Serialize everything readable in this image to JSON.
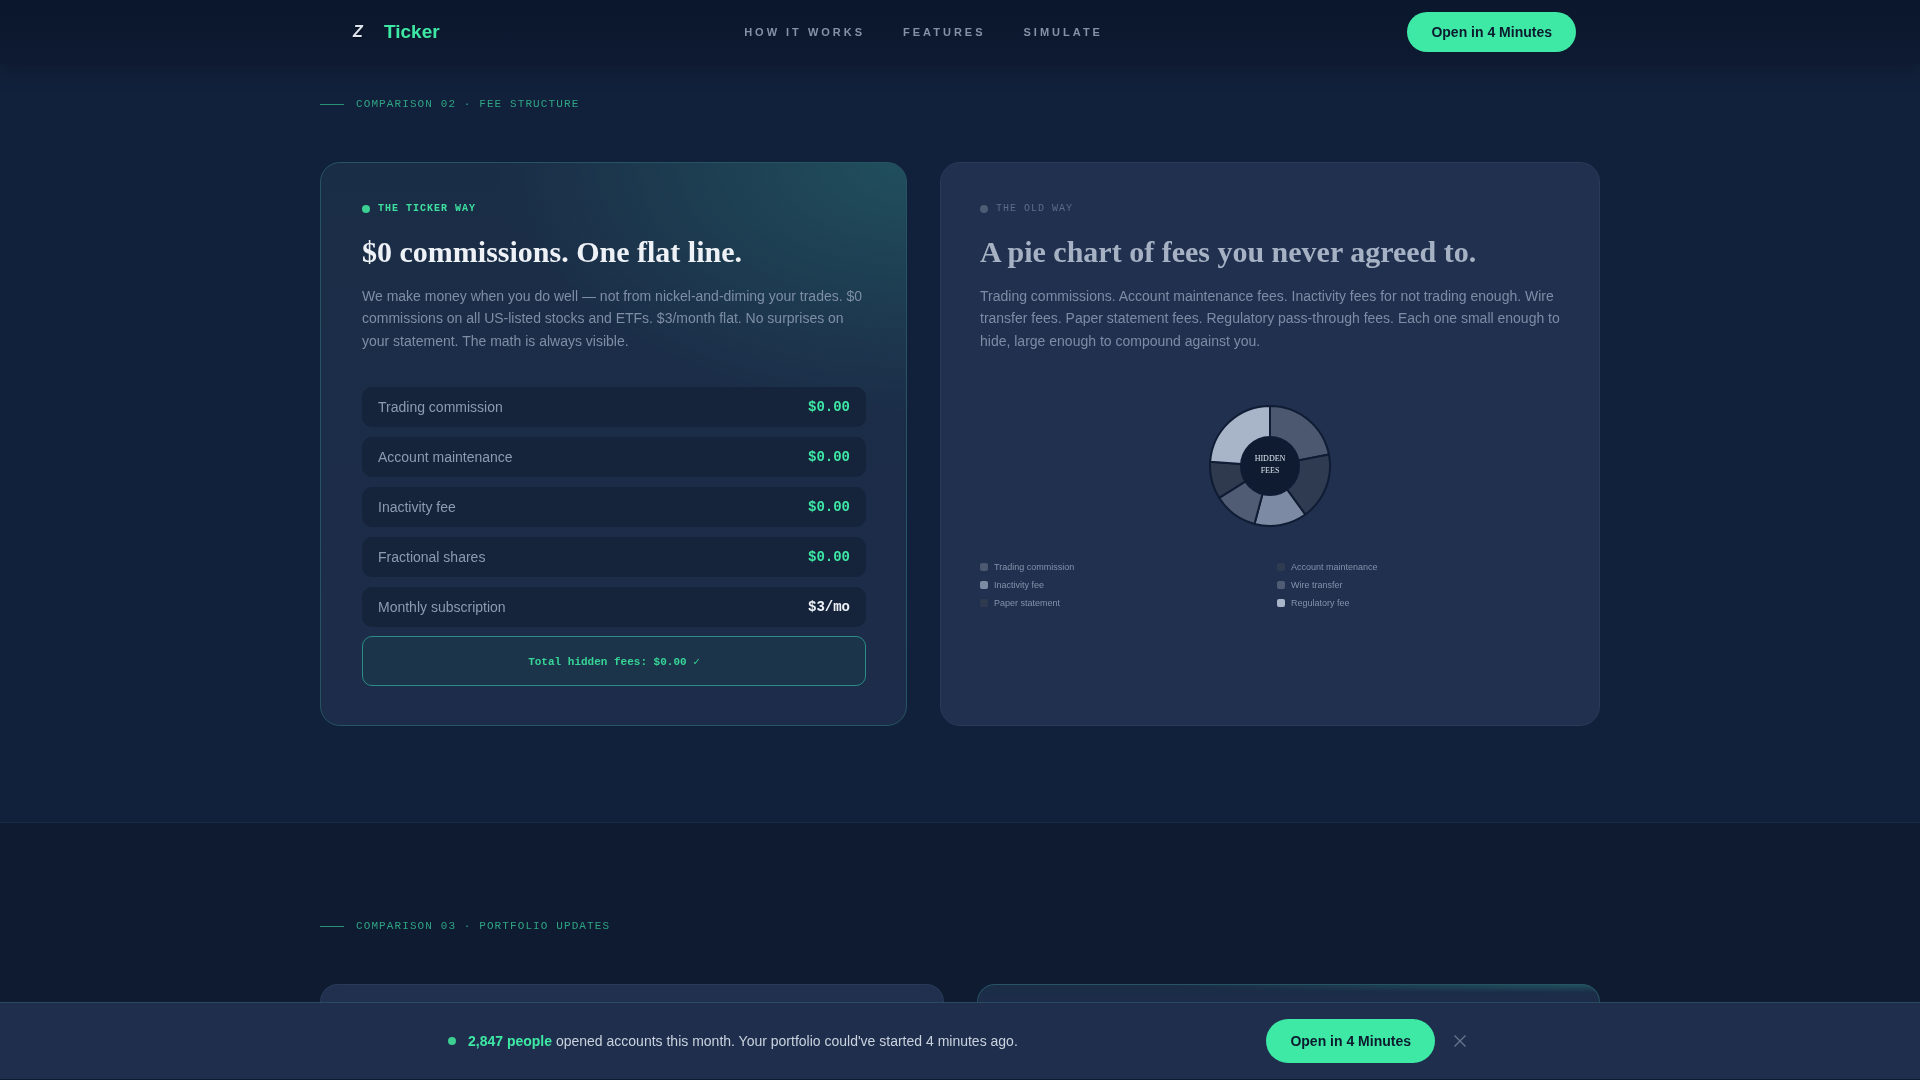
{
  "header": {
    "logo_mark": "Z",
    "brand": "Ticker",
    "nav": [
      "HOW IT WORKS",
      "FEATURES",
      "SIMULATE"
    ],
    "cta": "Open in 4 Minutes"
  },
  "sections": [
    {
      "eyebrow": "COMPARISON 02 · FEE STRUCTURE",
      "cards": [
        {
          "kind": "ticker",
          "tag": "THE TICKER WAY",
          "title": "$0 commissions. One flat line.",
          "body": "We make money when you do well — not from nickel-and-diming your trades. $0 commissions on all US-listed stocks and ETFs. $3/month flat. No surprises on your statement. The math is always visible.",
          "fees": [
            {
              "label": "Trading commission",
              "value": "$0.00",
              "free": true
            },
            {
              "label": "Account maintenance",
              "value": "$0.00",
              "free": true
            },
            {
              "label": "Inactivity fee",
              "value": "$0.00",
              "free": true
            },
            {
              "label": "Fractional shares",
              "value": "$0.00",
              "free": true
            },
            {
              "label": "Monthly subscription",
              "value": "$3/mo",
              "free": false
            }
          ],
          "total": "Total hidden fees: $0.00 ✓"
        },
        {
          "kind": "old",
          "tag": "THE OLD WAY",
          "title": "A pie chart of fees you never agreed to.",
          "body": "Trading commissions. Account maintenance fees. Inactivity fees for not trading enough. Wire transfer fees. Paper statement fees. Regulatory pass-through fees. Each one small enough to hide, large enough to compound against you.",
          "pie_label": "HIDDEN FEES",
          "legend": [
            {
              "label": "Trading commission",
              "color": "#4b5870"
            },
            {
              "label": "Account maintenance",
              "color": "#2e3b50"
            },
            {
              "label": "Inactivity fee",
              "color": "#7c8aa3"
            },
            {
              "label": "Wire transfer",
              "color": "#4f5c74"
            },
            {
              "label": "Paper statement",
              "color": "#2f3a4e"
            },
            {
              "label": "Regulatory fee",
              "color": "#a8b4c8"
            }
          ]
        }
      ]
    },
    {
      "eyebrow": "COMPARISON 03 · PORTFOLIO UPDATES",
      "cards": [
        {
          "kind": "old"
        },
        {
          "kind": "ticker"
        }
      ]
    }
  ],
  "banner": {
    "text": "**2,847 people** opened accounts this month. Your portfolio could've started 4 minutes ago.",
    "cta": "Open in 4 Minutes"
  }
}
